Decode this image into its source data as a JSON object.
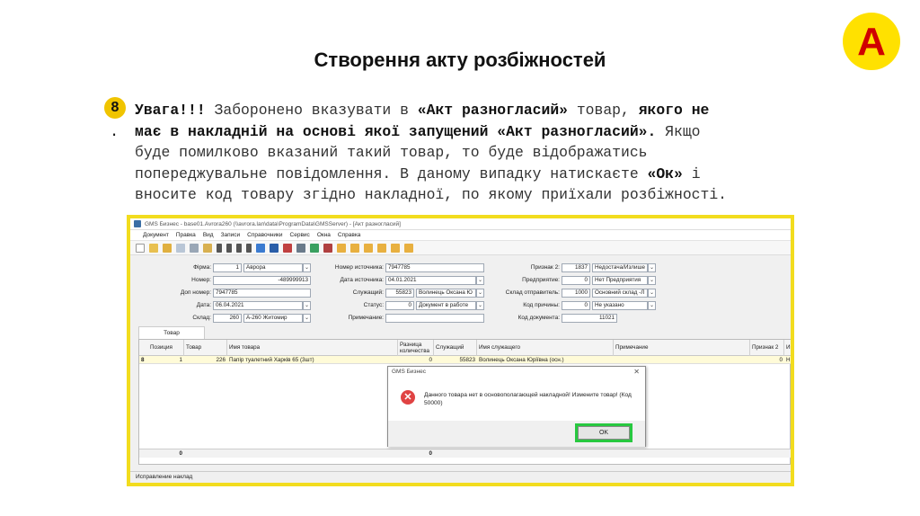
{
  "slide": {
    "title": "Створення акту розбіжностей",
    "logo_letter": "A",
    "step_number": "8",
    "step_dot": ".",
    "paragraph": {
      "l1_bold1": "Увага!!!",
      "l1_text1": " Заборонено вказувати в ",
      "l1_bold2": "«Акт разногласий»",
      "l1_text2": " товар, ",
      "l1_bold3": "якого не",
      "l2_bold1": "має в накладній на основі якої запущений «Акт разногласий».",
      "l2_text1": " Якщо",
      "l3": "буде помилково вказаний такий товар, то буде відображатись",
      "l4_text1": "попереджувальне повідомлення. В даному випадку натискаєте ",
      "l4_bold1": "«Ок»",
      "l4_text2": " і",
      "l5": "вносите код товару згідно накладної, по якому приїхали розбіжності."
    }
  },
  "window": {
    "title": "GMS Бизнес - base01.Avrora260 (\\\\avrora.lan\\data\\ProgramData\\GMSServer) - [Акт разногласий]",
    "menu": [
      "Документ",
      "Правка",
      "Вид",
      "Записи",
      "Справочники",
      "Сервис",
      "Окна",
      "Справка"
    ],
    "form": {
      "firma_label": "Фірма:",
      "firma_code": "1",
      "firma_name": "Аврора",
      "nomer_label": "Номер:",
      "nomer_value": "-489999913",
      "dopnomer_label": "Доп номер:",
      "dopnomer_value": "7947785",
      "data_label": "Дата:",
      "data_value": "06.04.2021",
      "sklad_label": "Склад:",
      "sklad_code": "260",
      "sklad_name": "А-260 Житомир",
      "nomer_ist_label": "Номер источника:",
      "nomer_ist_value": "7947785",
      "data_ist_label": "Дата источника:",
      "data_ist_value": "04.01.2021",
      "sluzh_label": "Служащий:",
      "sluzh_code": "55823",
      "sluzh_name": "Волинець Оксана Ю",
      "status_label": "Статус:",
      "status_code": "0",
      "status_name": "Документ в работе",
      "prim_label": "Примечание:",
      "prim_value": "",
      "priznak_label": "Признак 2:",
      "priznak_code": "1837",
      "priznak_name": "Недостача/Излише",
      "pred_label": "Предприятие:",
      "pred_code": "0",
      "pred_name": "Нет Предприятия",
      "sklad_otpr_label": "Склад отправитель:",
      "sklad_otpr_code": "1000",
      "sklad_otpr_name": "Основний склад -Л",
      "kod_prich_label": "Код причины:",
      "kod_prich_code": "0",
      "kod_prich_name": "Не указано",
      "kod_doc_label": "Код документа:",
      "kod_doc_value": "11021"
    },
    "tab_label": "Товар",
    "grid": {
      "headers": [
        "Позиция",
        "Товар",
        "Имя товара",
        "Разница количества",
        "Служащий",
        "Имя служащего",
        "Примечание",
        "Признак 2",
        "Им"
      ],
      "row": {
        "marker": "8",
        "pos": "1",
        "tovar": "226",
        "name": "Папір туалетний Харків 65 (3шт)",
        "diff": "0",
        "sluzh": "55823",
        "sluzh_name": "Волинець Оксана Юріївна (осн.)",
        "prim": "",
        "priznak": "0",
        "im": "Н"
      },
      "footer_pos": "0",
      "footer_diff": "0"
    },
    "status_text": "Исправление наклад"
  },
  "dialog": {
    "title": "GMS Бизнес",
    "close": "✕",
    "message": "Данного товара нет в основополагающей накладной! Измените товар! (Код 50000)",
    "ok_label": "OK"
  },
  "colors": {
    "frame": "#f2dc1e",
    "logo_bg": "#ffe100",
    "logo_fg": "#d00000",
    "badge": "#f0c400",
    "ok_highlight": "#28c840",
    "error_icon": "#e04343"
  }
}
